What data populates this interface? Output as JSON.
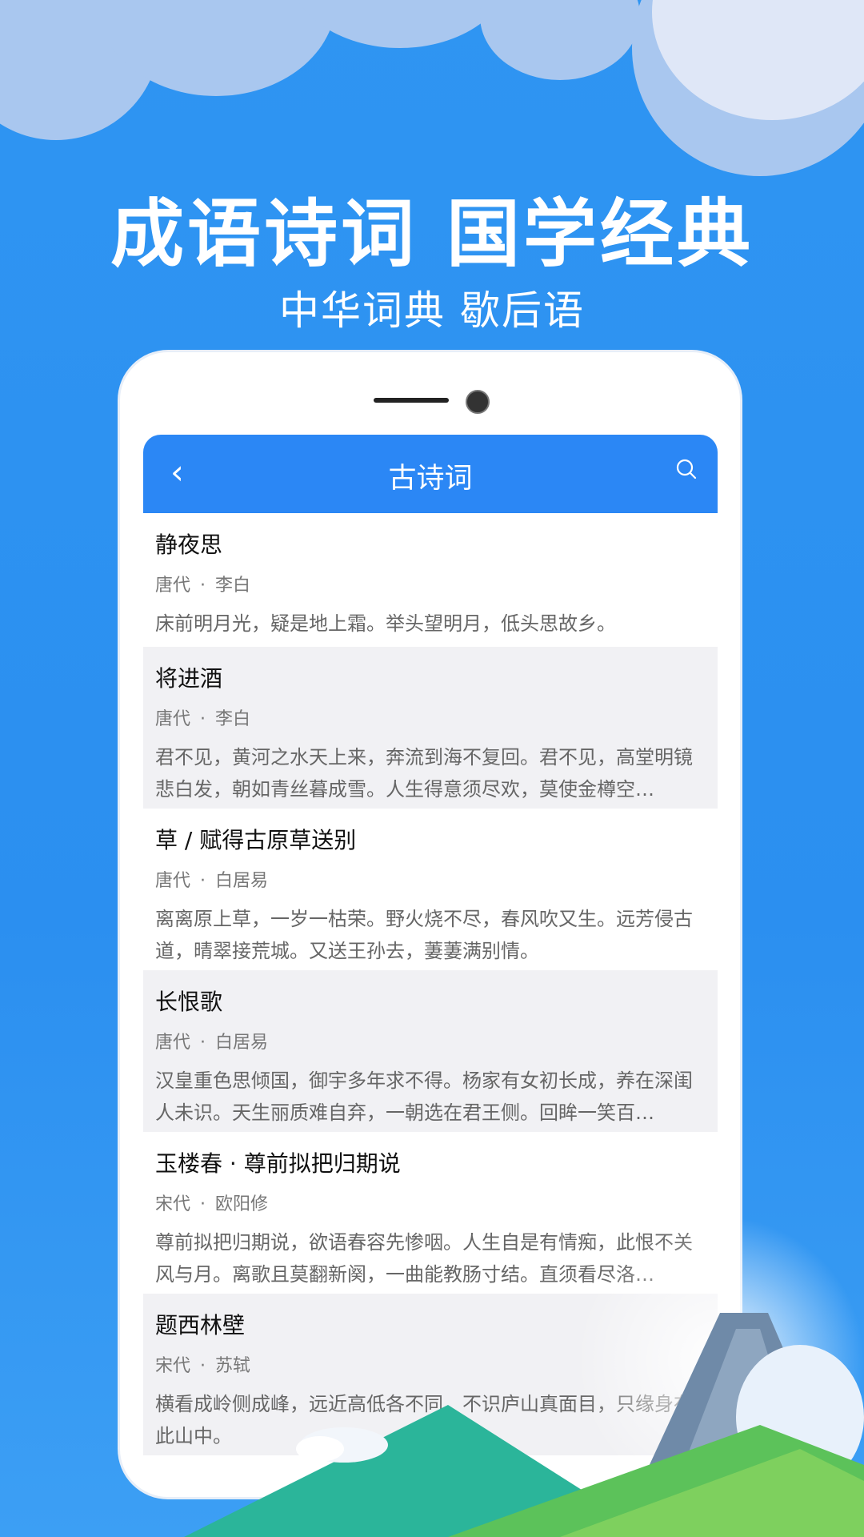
{
  "promo": {
    "headline": "成语诗词 国学经典",
    "subline": "中华词典 歇后语"
  },
  "appbar": {
    "title": "古诗词",
    "back_icon": "chevron-left-icon",
    "search_icon": "search-icon",
    "color": "#2b87f5"
  },
  "poems": [
    {
      "title": "静夜思",
      "dynasty": "唐代",
      "author": "李白",
      "text": "床前明月光，疑是地上霜。举头望明月，低头思故乡。"
    },
    {
      "title": "将进酒",
      "dynasty": "唐代",
      "author": "李白",
      "text": "君不见，黄河之水天上来，奔流到海不复回。君不见，高堂明镜悲白发，朝如青丝暮成雪。人生得意须尽欢，莫使金樽空…"
    },
    {
      "title": "草 / 赋得古原草送别",
      "dynasty": "唐代",
      "author": "白居易",
      "text": "离离原上草，一岁一枯荣。野火烧不尽，春风吹又生。远芳侵古道，晴翠接荒城。又送王孙去，萋萋满别情。"
    },
    {
      "title": "长恨歌",
      "dynasty": "唐代",
      "author": "白居易",
      "text": "汉皇重色思倾国，御宇多年求不得。杨家有女初长成，养在深闺人未识。天生丽质难自弃，一朝选在君王侧。回眸一笑百…"
    },
    {
      "title": "玉楼春 · 尊前拟把归期说",
      "dynasty": "宋代",
      "author": "欧阳修",
      "text": "尊前拟把归期说，欲语春容先惨咽。人生自是有情痴，此恨不关风与月。离歌且莫翻新阕，一曲能教肠寸结。直须看尽洛…"
    },
    {
      "title": "题西林壁",
      "dynasty": "宋代",
      "author": "苏轼",
      "text": "横看成岭侧成峰，远近高低各不同。不识庐山真面目，只缘身在此山中。"
    }
  ],
  "separator": "·"
}
